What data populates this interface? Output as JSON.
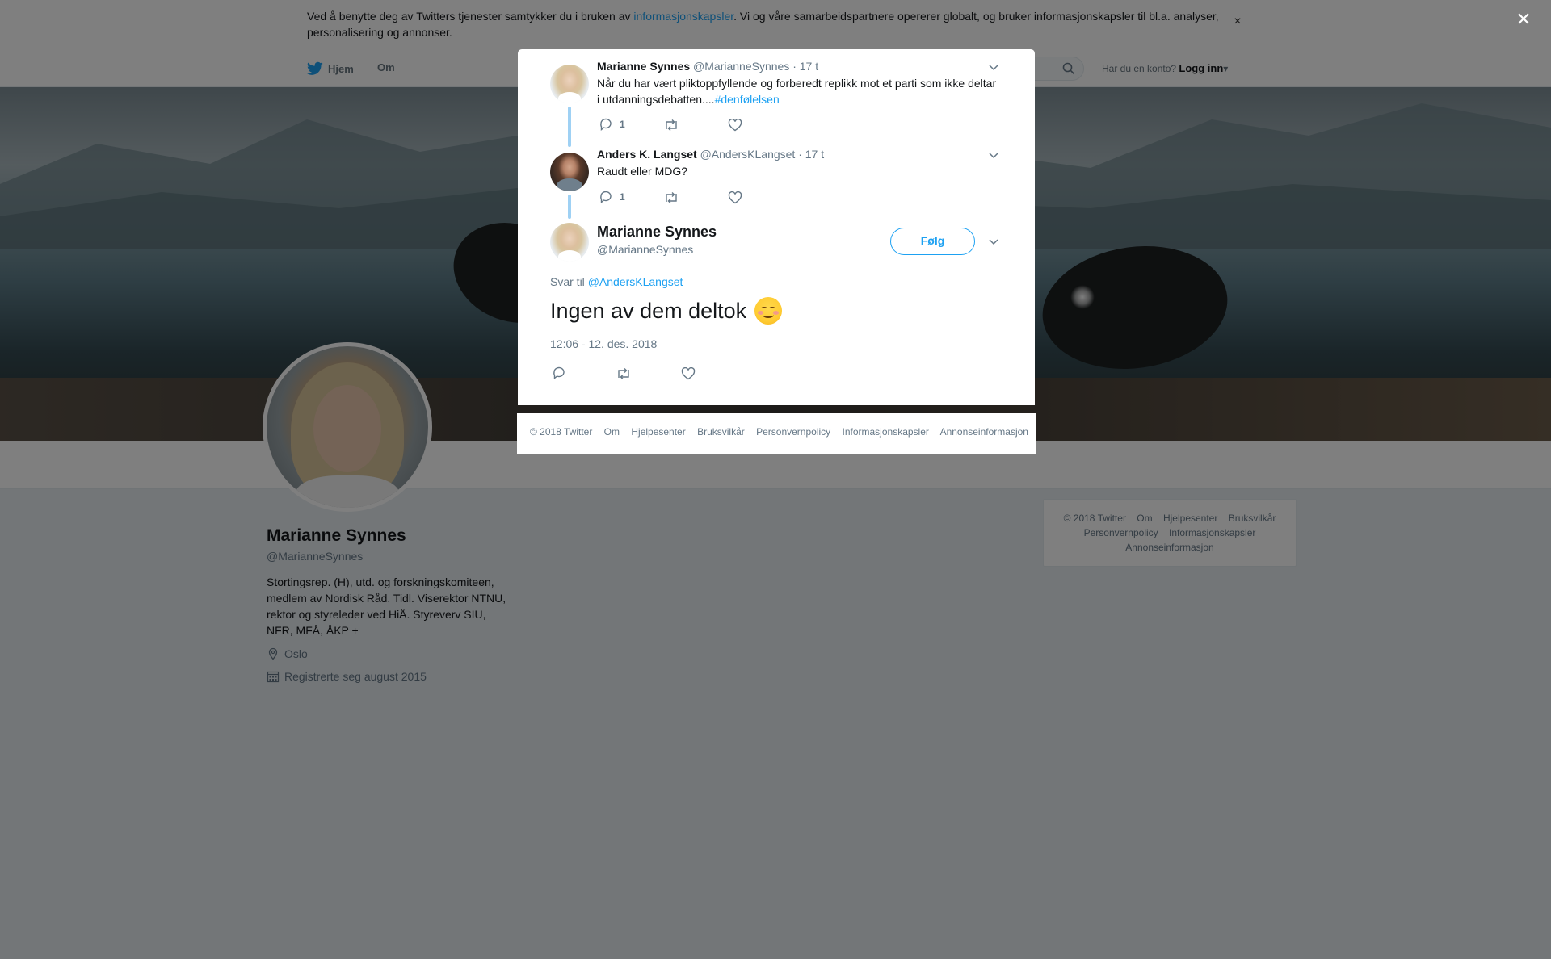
{
  "cookie": {
    "text_before": "Ved å benytte deg av Twitters tjenester samtykker du i bruken av ",
    "link": "informasjonskapsler",
    "text_after": ". Vi og våre samarbeidspartnere opererer globalt, og bruker informasjonskapsler til bl.a. analyser, personalisering og annonser.",
    "close": "×"
  },
  "nav": {
    "home": "Hjem",
    "about": "Om",
    "login_prompt": "Har du en konto?",
    "login": "Logg inn"
  },
  "profile": {
    "name": "Marianne Synnes",
    "handle": "@MarianneSynnes",
    "bio": "Stortingsrep. (H), utd. og forskningskomiteen, medlem av Nordisk Råd. Tidl. Viserektor NTNU, rektor og styreleder ved HiÅ. Styreverv SIU, NFR, MFÅ, ÅKP +",
    "location": "Oslo",
    "joined": "Registrerte seg august 2015"
  },
  "side_footer": {
    "items": [
      "© 2018 Twitter",
      "Om",
      "Hjelpesenter",
      "Bruksvilkår",
      "Personvernpolicy",
      "Informasjonskapsler",
      "Annonseinformasjon"
    ]
  },
  "overlay_close": "×",
  "modal": {
    "tweets": [
      {
        "name": "Marianne Synnes",
        "handle": "@MarianneSynnes",
        "time": "· 17 t",
        "text": "Når du har vært pliktoppfyllende og forberedt replikk mot et parti som ikke deltar i utdanningsdebatten....",
        "hashtag": "#denfølelsen",
        "reply_count": "1"
      },
      {
        "name": "Anders K. Langset",
        "handle": "@AndersKLangset",
        "time": "· 17 t",
        "text": "Raudt eller MDG?",
        "reply_count": "1"
      }
    ],
    "main": {
      "name": "Marianne Synnes",
      "handle": "@MarianneSynnes",
      "follow": "Følg",
      "reply_prefix": "Svar til",
      "reply_to": "@AndersKLangset",
      "text": "Ingen av dem deltok",
      "emoji": "smiling-face-emoji",
      "timestamp": "12:06 - 12. des. 2018"
    },
    "footer": [
      "© 2018 Twitter",
      "Om",
      "Hjelpesenter",
      "Bruksvilkår",
      "Personvernpolicy",
      "Informasjonskapsler",
      "Annonseinformasjon"
    ]
  },
  "colors": {
    "accent": "#1da1f2",
    "thread_line": "#9fd1f4",
    "text_secondary": "#657786"
  }
}
